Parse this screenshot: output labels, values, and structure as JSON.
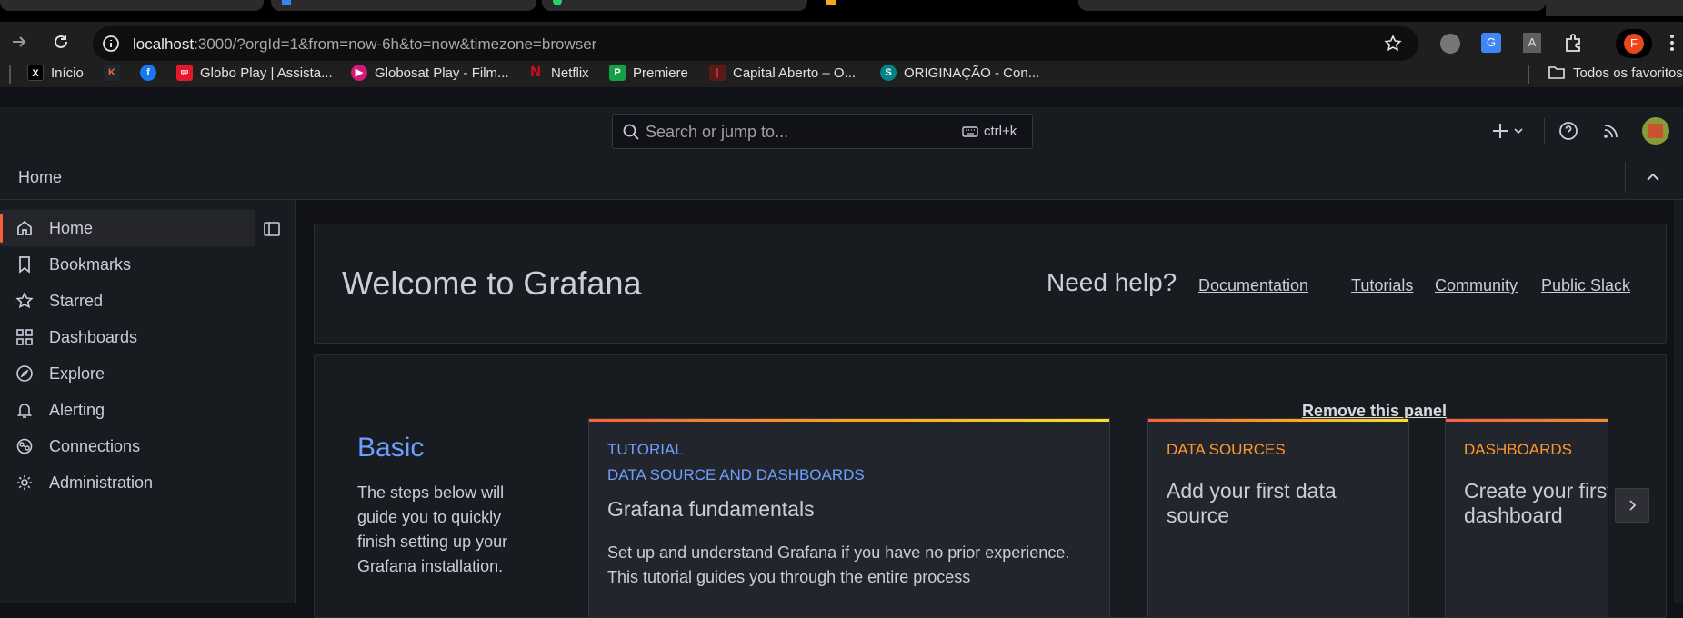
{
  "browser": {
    "url_host": "localhost",
    "url_rest": ":3000/?orgId=1&from=now-6h&to=now&timezone=browser",
    "profile_initial": "F",
    "bookmarks": [
      {
        "label": "Início",
        "icon": "x-logo-icon"
      },
      {
        "label": "",
        "icon": "kaggle-k-icon"
      },
      {
        "label": "",
        "icon": "facebook-icon"
      },
      {
        "label": "Globo Play | Assista...",
        "icon": "globoplay-icon"
      },
      {
        "label": "Globosat Play - Film...",
        "icon": "globosat-play-icon"
      },
      {
        "label": "Netflix",
        "icon": "netflix-icon"
      },
      {
        "label": "Premiere",
        "icon": "premiere-icon"
      },
      {
        "label": "Capital Aberto – O...",
        "icon": "capital-aberto-icon"
      },
      {
        "label": "ORIGINAÇÃO - Con...",
        "icon": "sharepoint-icon"
      }
    ],
    "all_bookmarks_label": "Todos os favoritos"
  },
  "grafana": {
    "search_placeholder": "Search or jump to...",
    "search_shortcut": "ctrl+k",
    "breadcrumb": "Home",
    "nav": [
      {
        "label": "Home",
        "icon": "home-icon",
        "active": true
      },
      {
        "label": "Bookmarks",
        "icon": "bookmark-icon"
      },
      {
        "label": "Starred",
        "icon": "star-icon"
      },
      {
        "label": "Dashboards",
        "icon": "apps-icon"
      },
      {
        "label": "Explore",
        "icon": "compass-icon"
      },
      {
        "label": "Alerting",
        "icon": "bell-icon"
      },
      {
        "label": "Connections",
        "icon": "connections-icon"
      },
      {
        "label": "Administration",
        "icon": "cog-icon"
      }
    ],
    "welcome": {
      "title": "Welcome to Grafana",
      "help_label": "Need help?",
      "links": [
        "Documentation",
        "Tutorials",
        "Community",
        "Public Slack"
      ]
    },
    "getting_started": {
      "remove_label": "Remove this panel",
      "basic_title": "Basic",
      "basic_text": "The steps below will guide you to quickly finish setting up your Grafana installation.",
      "tutorial": {
        "kicker1": "TUTORIAL",
        "kicker2": "DATA SOURCE AND DASHBOARDS",
        "title": "Grafana fundamentals",
        "text": "Set up and understand Grafana if you have no prior experience. This tutorial guides you through the entire process"
      },
      "datasources": {
        "kicker": "DATA SOURCES",
        "title": "Add your first data source"
      },
      "dashboards": {
        "kicker": "DASHBOARDS",
        "title": "Create your first dashboard"
      }
    },
    "colors": {
      "accent": "#f55f3e",
      "blue": "#6e9fff",
      "orange": "#ff9830"
    }
  }
}
